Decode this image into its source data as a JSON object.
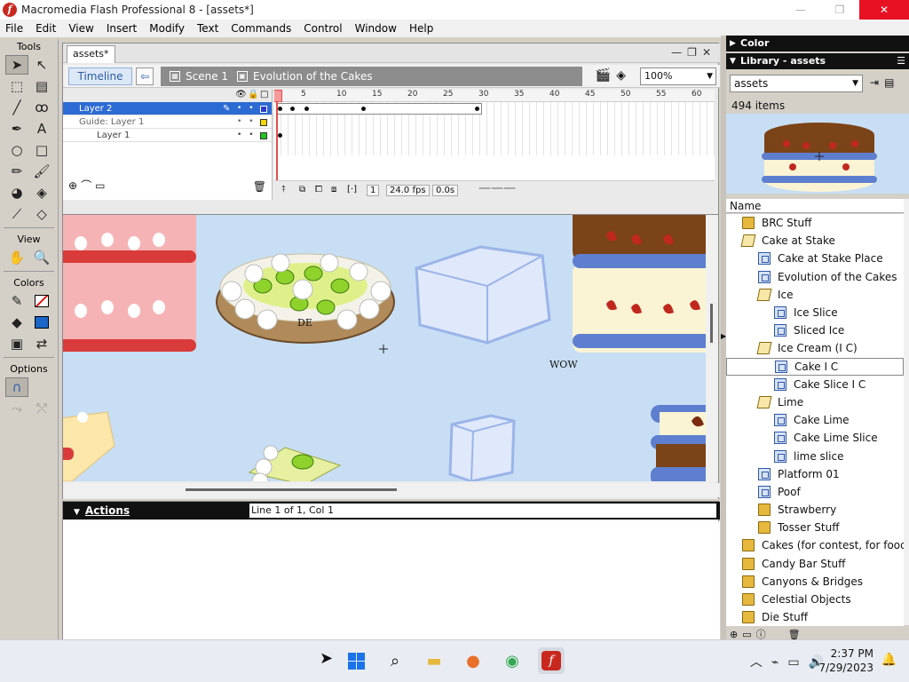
{
  "window": {
    "title": "Macromedia Flash Professional 8 - [assets*]",
    "minimize_icon": "minimize-icon",
    "maximize_icon": "maximize-icon",
    "close_icon": "close-icon"
  },
  "menu": [
    "File",
    "Edit",
    "View",
    "Insert",
    "Modify",
    "Text",
    "Commands",
    "Control",
    "Window",
    "Help"
  ],
  "tools": {
    "section_tools": "Tools",
    "section_view": "View",
    "section_colors": "Colors",
    "section_options": "Options"
  },
  "document_tab": "assets*",
  "timeline": {
    "timeline_button": "Timeline",
    "scene": "Scene 1",
    "symbol": "Evolution of the Cakes",
    "zoom": "100%",
    "layers": [
      {
        "name": "Layer 2"
      },
      {
        "name": "Guide: Layer 1"
      },
      {
        "name": "Layer 1"
      }
    ],
    "ruler": [
      "1",
      "5",
      "10",
      "15",
      "20",
      "25",
      "30",
      "35",
      "40",
      "45",
      "50",
      "55",
      "60"
    ],
    "current_frame": "1",
    "fps": "24.0 fps",
    "elapsed": "0.0s"
  },
  "stage": {
    "label_de": "DE",
    "label_wow": "WOW"
  },
  "actions": {
    "title": "Actions",
    "status": "Line 1 of 1, Col 1"
  },
  "panels": {
    "color_title": "Color",
    "library_title": "Library - assets",
    "library_select": "assets",
    "item_count": "494 items",
    "column_name": "Name"
  },
  "library_items": [
    {
      "label": "BRC Stuff",
      "indent": 1,
      "type": "folder"
    },
    {
      "label": "Cake at Stake",
      "indent": 1,
      "type": "open"
    },
    {
      "label": "Cake at Stake Place",
      "indent": 2,
      "type": "clip"
    },
    {
      "label": "Evolution of the Cakes",
      "indent": 2,
      "type": "clip"
    },
    {
      "label": "Ice",
      "indent": 2,
      "type": "open"
    },
    {
      "label": "Ice Slice",
      "indent": 3,
      "type": "clip"
    },
    {
      "label": "Sliced Ice",
      "indent": 3,
      "type": "clip"
    },
    {
      "label": "Ice Cream (I C)",
      "indent": 2,
      "type": "open"
    },
    {
      "label": "Cake I C",
      "indent": 3,
      "type": "clip",
      "selected": true
    },
    {
      "label": "Cake Slice I C",
      "indent": 3,
      "type": "clip"
    },
    {
      "label": "Lime",
      "indent": 2,
      "type": "open"
    },
    {
      "label": "Cake Lime",
      "indent": 3,
      "type": "clip"
    },
    {
      "label": "Cake Lime Slice",
      "indent": 3,
      "type": "clip"
    },
    {
      "label": "lime slice",
      "indent": 3,
      "type": "clip"
    },
    {
      "label": "Platform 01",
      "indent": 2,
      "type": "clip"
    },
    {
      "label": "Poof",
      "indent": 2,
      "type": "clip"
    },
    {
      "label": "Strawberry",
      "indent": 2,
      "type": "folder"
    },
    {
      "label": "Tosser Stuff",
      "indent": 2,
      "type": "folder"
    },
    {
      "label": "Cakes (for contest, for food",
      "indent": 1,
      "type": "folder"
    },
    {
      "label": "Candy Bar Stuff",
      "indent": 1,
      "type": "folder"
    },
    {
      "label": "Canyons & Bridges",
      "indent": 1,
      "type": "folder"
    },
    {
      "label": "Celestial Objects",
      "indent": 1,
      "type": "folder"
    },
    {
      "label": "Die Stuff",
      "indent": 1,
      "type": "folder"
    }
  ],
  "taskbar": {
    "time": "2:37 PM",
    "date": "7/29/2023"
  },
  "colors": {
    "stage_bg": "#c7def4",
    "selection_blue": "#2c6bd3",
    "title_red": "#e81123"
  }
}
